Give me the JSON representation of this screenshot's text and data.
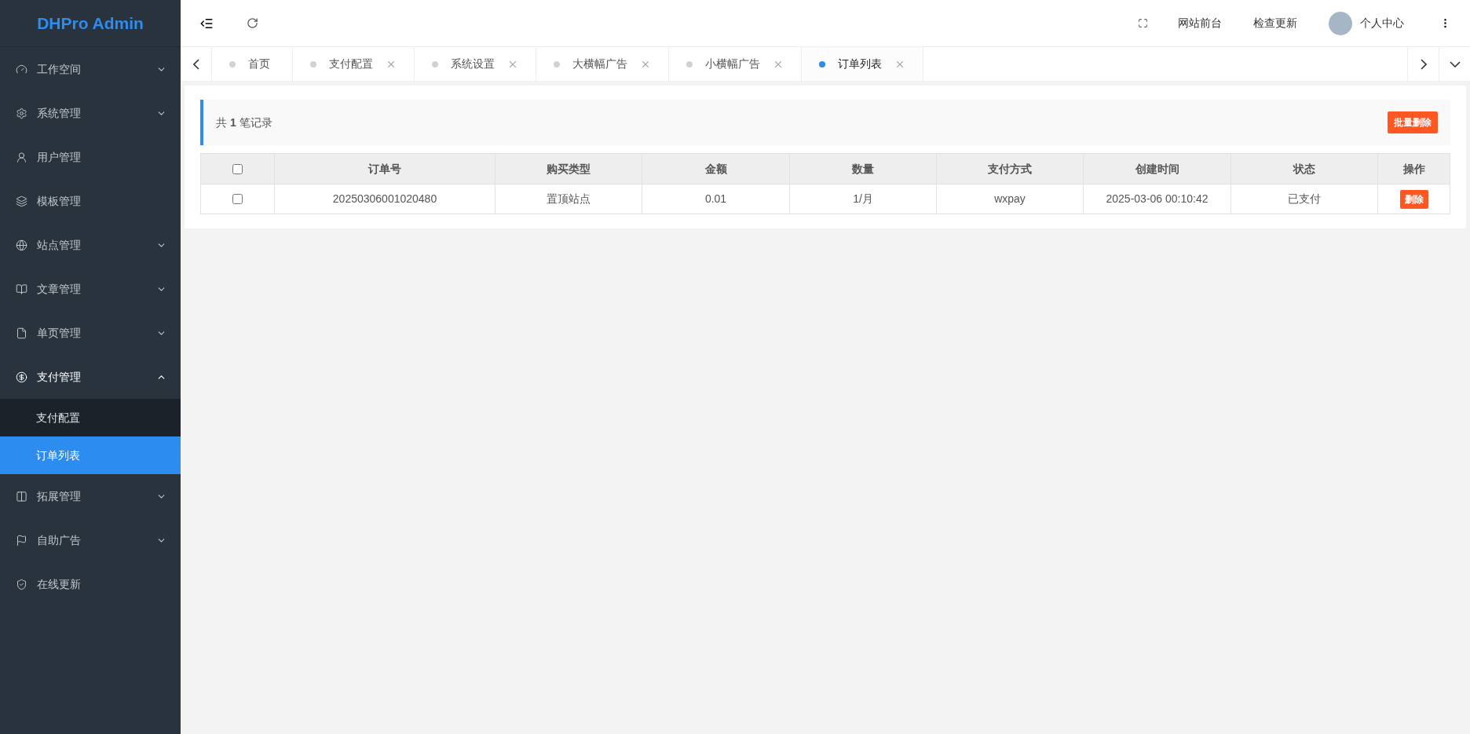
{
  "logo": "DHPro Admin",
  "sidebar": {
    "items": [
      {
        "label": "工作空间",
        "has_children": true,
        "expanded": false
      },
      {
        "label": "系统管理",
        "has_children": true,
        "expanded": false
      },
      {
        "label": "用户管理",
        "has_children": false,
        "expanded": false
      },
      {
        "label": "模板管理",
        "has_children": false,
        "expanded": false
      },
      {
        "label": "站点管理",
        "has_children": true,
        "expanded": false
      },
      {
        "label": "文章管理",
        "has_children": true,
        "expanded": false
      },
      {
        "label": "单页管理",
        "has_children": true,
        "expanded": false
      },
      {
        "label": "支付管理",
        "has_children": true,
        "expanded": true,
        "children": [
          {
            "label": "支付配置",
            "selected": false
          },
          {
            "label": "订单列表",
            "selected": true
          }
        ]
      },
      {
        "label": "拓展管理",
        "has_children": true,
        "expanded": false
      },
      {
        "label": "自助广告",
        "has_children": true,
        "expanded": false
      },
      {
        "label": "在线更新",
        "has_children": false,
        "expanded": false
      }
    ]
  },
  "header": {
    "links": [
      "网站前台",
      "检查更新"
    ],
    "user": "个人中心"
  },
  "tabs": [
    {
      "label": "首页",
      "closable": false,
      "selected": false
    },
    {
      "label": "支付配置",
      "closable": true,
      "selected": false
    },
    {
      "label": "系统设置",
      "closable": true,
      "selected": false
    },
    {
      "label": "大横幅广告",
      "closable": true,
      "selected": false
    },
    {
      "label": "小横幅广告",
      "closable": true,
      "selected": false
    },
    {
      "label": "订单列表",
      "closable": true,
      "selected": true
    }
  ],
  "summary": "共 **1** 笔记录",
  "batch_delete": "批量删除",
  "table": {
    "columns": [
      "订单号",
      "购买类型",
      "金额",
      "数量",
      "支付方式",
      "创建时间",
      "状态",
      "操作"
    ],
    "select_all": false,
    "rows": [
      {
        "checked": false,
        "cells": [
          "20250306001020480",
          "置顶站点",
          "0.01",
          "1/月",
          "wxpay",
          "2025-03-06 00:10:42",
          "已支付"
        ],
        "action": "删除"
      }
    ]
  }
}
